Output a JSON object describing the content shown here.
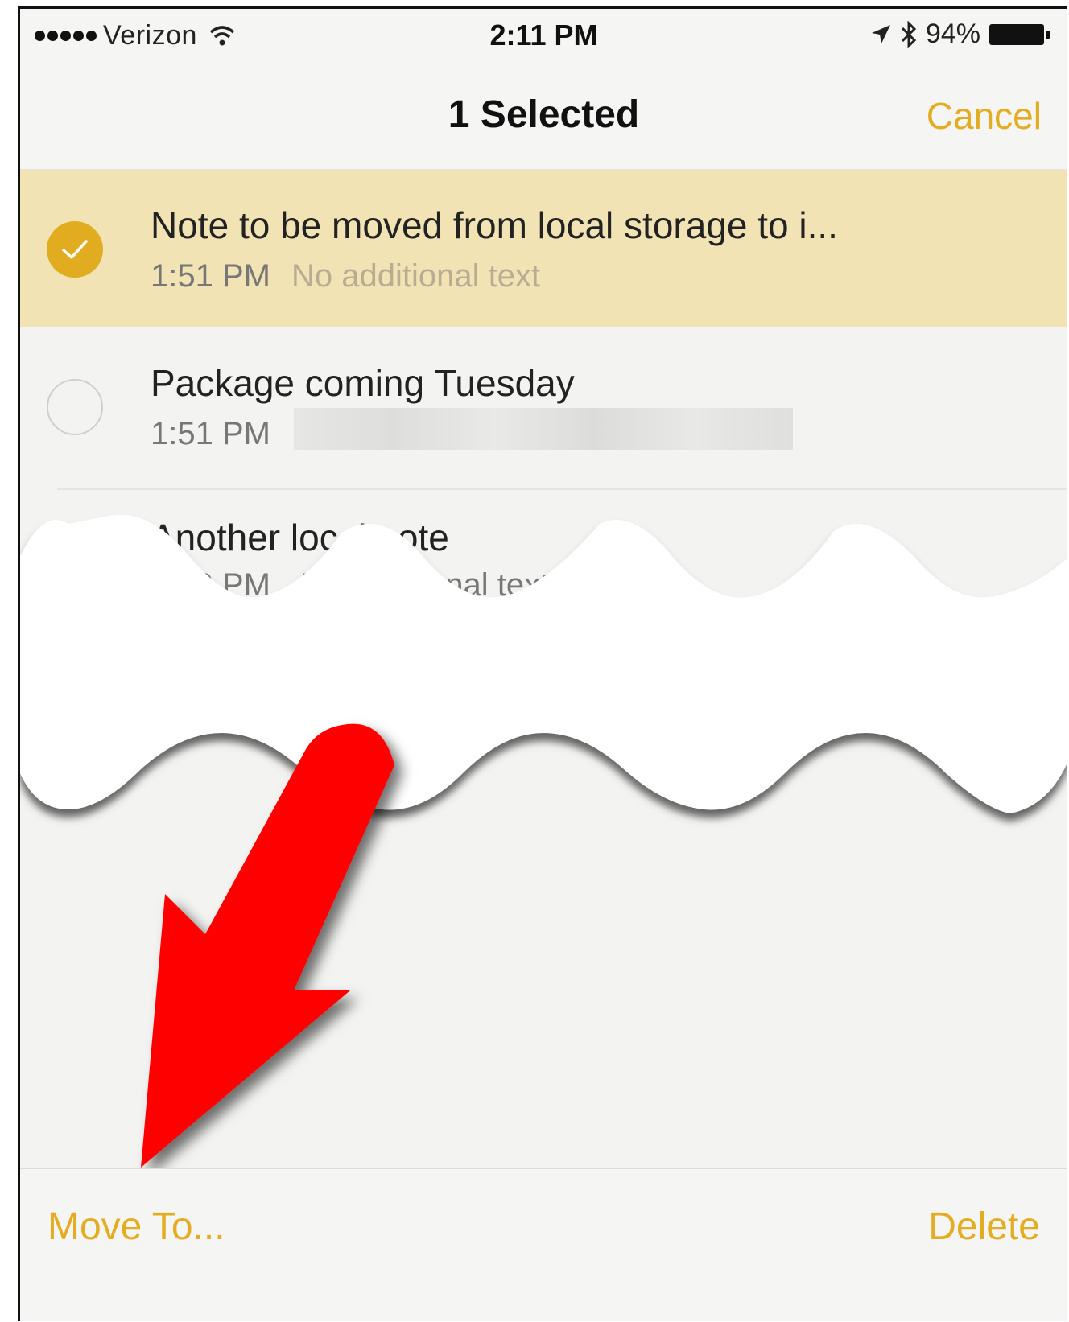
{
  "status_bar": {
    "carrier": "Verizon",
    "time": "2:11 PM",
    "battery": "94%",
    "icons": [
      "signal-dots-icon",
      "wifi-icon",
      "location-arrow-icon",
      "bluetooth-icon",
      "battery-icon"
    ]
  },
  "navbar": {
    "title": "1 Selected",
    "cancel_label": "Cancel"
  },
  "notes": [
    {
      "title": "Note to be moved from local storage to i...",
      "time": "1:51 PM",
      "preview": "No additional text",
      "selected": true
    },
    {
      "title": "Package coming Tuesday",
      "time": "1:51 PM",
      "preview": "",
      "selected": false
    },
    {
      "title": "Another local note",
      "time": "1:50 PM",
      "preview": "No additional text",
      "selected": false
    }
  ],
  "toolbar": {
    "move_to_label": "Move To...",
    "delete_label": "Delete"
  },
  "colors": {
    "accent": "#e3ac21",
    "selected_row": "#f2e3b5",
    "annotation_arrow": "#ff0000"
  }
}
